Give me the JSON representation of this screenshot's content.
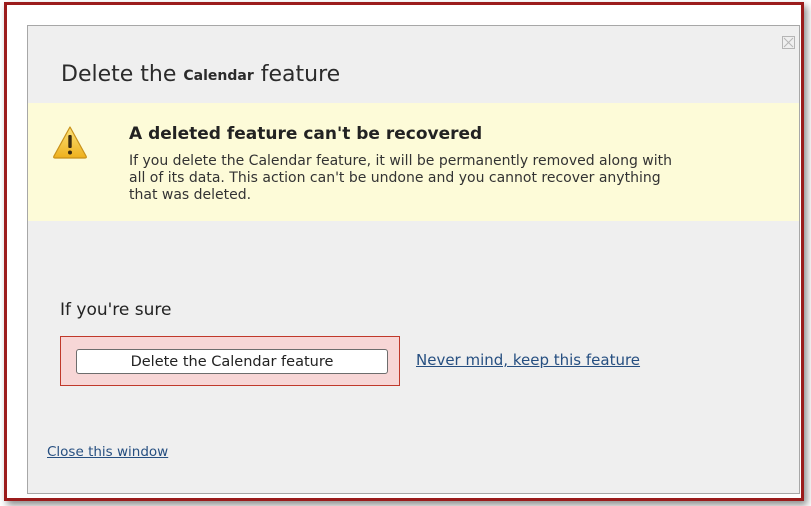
{
  "dialog": {
    "title_prefix": "Delete the",
    "title_feature": "Calendar",
    "title_suffix": "feature",
    "close_icon": "close-x-icon"
  },
  "warning": {
    "icon": "warning-triangle-icon",
    "icon_color": "#f0c419",
    "background": "#fdfbd8",
    "heading": "A deleted feature can't be recovered",
    "body": "If you delete the Calendar feature, it will be permanently removed along with all of its data. This action can't be undone and you cannot recover anything that was deleted."
  },
  "confirm": {
    "heading": "If you're sure",
    "delete_button_label": "Delete the Calendar feature",
    "keep_link_label": "Never mind, keep this feature"
  },
  "footer": {
    "close_window_label": "Close this window"
  },
  "colors": {
    "frame_border": "#9b1c1c",
    "highlight_fill": "#f7d6d6",
    "highlight_border": "#c0392b",
    "link": "#264f81"
  }
}
